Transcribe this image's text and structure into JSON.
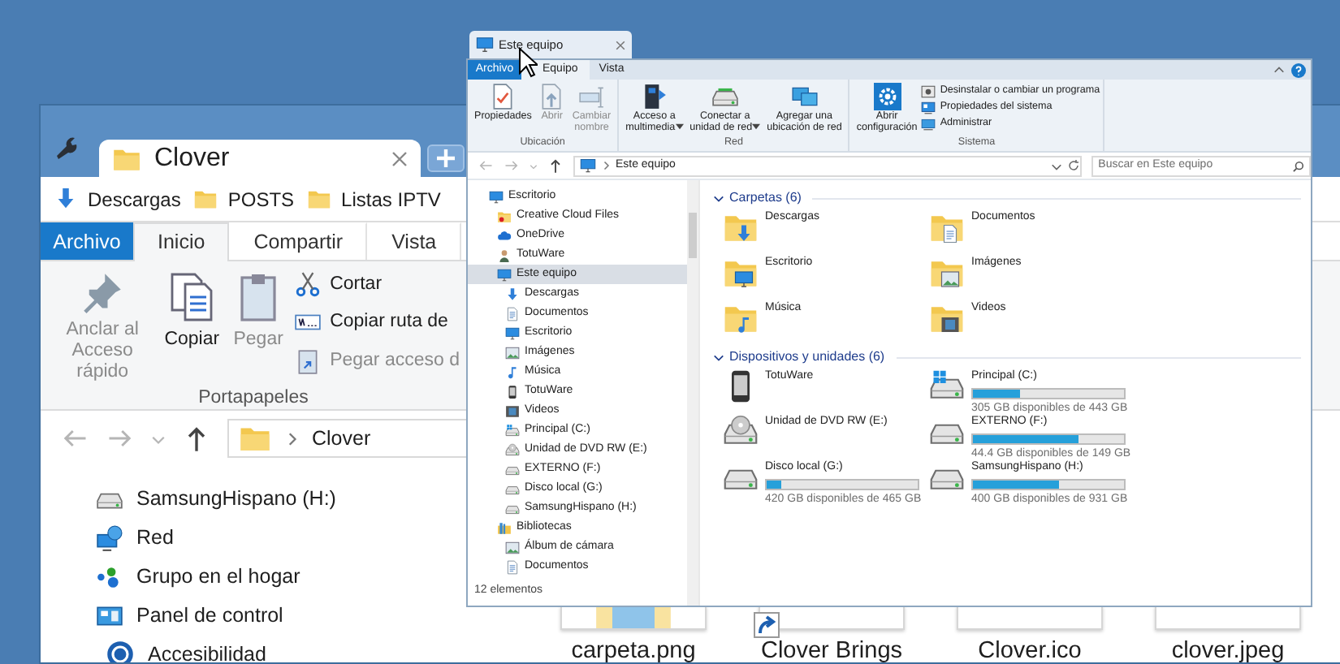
{
  "clover_window": {
    "tab": {
      "title": "Clover"
    },
    "bookmarks": [
      {
        "label": "Descargas",
        "kind": "download"
      },
      {
        "label": "POSTS",
        "kind": "folder"
      },
      {
        "label": "Listas IPTV",
        "kind": "folder"
      }
    ],
    "ribbon_tabs": [
      {
        "label": "Archivo",
        "kind": "file",
        "selected": false
      },
      {
        "label": "Inicio",
        "kind": "tab",
        "selected": true
      },
      {
        "label": "Compartir",
        "kind": "tab",
        "selected": false
      },
      {
        "label": "Vista",
        "kind": "tab",
        "selected": false
      }
    ],
    "clipboard_group": {
      "label": "Portapapeles",
      "large_buttons": [
        {
          "label": "Anclar al\nAcceso rápido",
          "kind": "pin",
          "disabled": true
        },
        {
          "label": "Copiar",
          "kind": "copy",
          "disabled": false
        },
        {
          "label": "Pegar",
          "kind": "paste",
          "disabled": true
        }
      ],
      "small_buttons": [
        {
          "label": "Cortar",
          "kind": "cut",
          "disabled": false
        },
        {
          "label": "Copiar ruta de",
          "kind": "path",
          "disabled": false
        },
        {
          "label": "Pegar acceso d",
          "kind": "shortcut",
          "disabled": true
        }
      ]
    },
    "address": {
      "path": "Clover"
    },
    "navigation": [
      {
        "label": "SamsungHispano (H:)",
        "kind": "drive"
      },
      {
        "label": "Red",
        "kind": "network"
      },
      {
        "label": "Grupo en el hogar",
        "kind": "homegroup"
      },
      {
        "label": "Panel de control",
        "kind": "control-panel",
        "children": [
          {
            "label": "Accesibilidad",
            "kind": "accessibility"
          }
        ]
      }
    ],
    "files": [
      {
        "name": "carpeta.png",
        "kind": "folder-image"
      },
      {
        "name": "Clover Brings",
        "kind": "shortcut"
      },
      {
        "name": "Clover.ico",
        "kind": "plain"
      },
      {
        "name": "clover.jpeg",
        "kind": "plain"
      }
    ]
  },
  "explorer_window": {
    "tab": {
      "title": "Este equipo"
    },
    "ribbon_tabs": [
      {
        "label": "Archivo",
        "kind": "file",
        "selected": false
      },
      {
        "label": "Equipo",
        "kind": "tab",
        "selected": true
      },
      {
        "label": "Vista",
        "kind": "tab",
        "selected": false
      }
    ],
    "groups": [
      {
        "label": "Ubicación",
        "buttons": [
          {
            "label": "Propiedades",
            "kind": "properties",
            "disabled": false,
            "menu": false
          },
          {
            "label": "Abrir",
            "kind": "open",
            "disabled": true,
            "menu": false
          },
          {
            "label": "Cambiar\nnombre",
            "kind": "rename",
            "disabled": true,
            "menu": false
          }
        ]
      },
      {
        "label": "Red",
        "buttons": [
          {
            "label": "Acceso a\nmultimedia",
            "kind": "media",
            "disabled": false,
            "menu": true
          },
          {
            "label": "Conectar a\nunidad de red",
            "kind": "map-drive",
            "disabled": false,
            "menu": true
          },
          {
            "label": "Agregar una\nubicación de red",
            "kind": "add-network",
            "disabled": false,
            "menu": false
          }
        ]
      },
      {
        "label": "Sistema",
        "buttons": [
          {
            "label": "Abrir\nconfiguración",
            "kind": "settings",
            "disabled": false,
            "menu": false
          }
        ],
        "small_buttons": [
          {
            "label": "Desinstalar o cambiar un programa",
            "kind": "uninstall"
          },
          {
            "label": "Propiedades del sistema",
            "kind": "system"
          },
          {
            "label": "Administrar",
            "kind": "manage"
          }
        ]
      }
    ],
    "address": {
      "path": "Este equipo"
    },
    "search": {
      "placeholder": "Buscar en Este equipo"
    },
    "tree": [
      {
        "label": "Escritorio",
        "kind": "desktop",
        "selected": false,
        "children": [
          {
            "label": "Creative Cloud Files",
            "kind": "cc-folder",
            "selected": false
          },
          {
            "label": "OneDrive",
            "kind": "cloud",
            "selected": false
          },
          {
            "label": "TotuWare",
            "kind": "person",
            "selected": false
          },
          {
            "label": "Este equipo",
            "kind": "desktop",
            "selected": true,
            "children": [
              {
                "label": "Descargas",
                "kind": "download",
                "selected": false
              },
              {
                "label": "Documentos",
                "kind": "document",
                "selected": false
              },
              {
                "label": "Escritorio",
                "kind": "desktop",
                "selected": false
              },
              {
                "label": "Imágenes",
                "kind": "image",
                "selected": false
              },
              {
                "label": "Música",
                "kind": "music",
                "selected": false
              },
              {
                "label": "TotuWare",
                "kind": "phone",
                "selected": false
              },
              {
                "label": "Videos",
                "kind": "video",
                "selected": false
              },
              {
                "label": "Principal (C:)",
                "kind": "windows-drive",
                "selected": false
              },
              {
                "label": "Unidad de DVD RW (E:)",
                "kind": "dvd",
                "selected": false
              },
              {
                "label": "EXTERNO (F:)",
                "kind": "drive",
                "selected": false
              },
              {
                "label": "Disco local (G:)",
                "kind": "drive",
                "selected": false
              },
              {
                "label": "SamsungHispano (H:)",
                "kind": "drive",
                "selected": false
              }
            ]
          },
          {
            "label": "Bibliotecas",
            "kind": "library",
            "selected": false,
            "children": [
              {
                "label": "Álbum de cámara",
                "kind": "image",
                "selected": false
              },
              {
                "label": "Documentos",
                "kind": "document",
                "selected": false
              }
            ]
          }
        ]
      }
    ],
    "status": "12 elementos",
    "sections": [
      {
        "title": "Carpetas (6)",
        "expanded": true,
        "items": [
          {
            "name": "Descargas",
            "kind": "download"
          },
          {
            "name": "Documentos",
            "kind": "document"
          },
          {
            "name": "Escritorio",
            "kind": "desktop"
          },
          {
            "name": "Imágenes",
            "kind": "image"
          },
          {
            "name": "Música",
            "kind": "music"
          },
          {
            "name": "Videos",
            "kind": "video"
          }
        ]
      },
      {
        "title": "Dispositivos y unidades (6)",
        "expanded": true,
        "items": [
          {
            "name": "TotuWare",
            "kind": "phone"
          },
          {
            "name": "Principal (C:)",
            "kind": "windows-drive",
            "level": 0.31,
            "reading": "305 GB disponibles de 443 GB"
          },
          {
            "name": "Unidad de DVD RW (E:)",
            "kind": "dvd"
          },
          {
            "name": "EXTERNO (F:)",
            "kind": "drive",
            "level": 0.7,
            "reading": "44.4 GB disponibles de 149 GB"
          },
          {
            "name": "Disco local (G:)",
            "kind": "drive",
            "level": 0.1,
            "reading": "420 GB disponibles de 465 GB"
          },
          {
            "name": "SamsungHispano (H:)",
            "kind": "drive",
            "level": 0.57,
            "reading": "400 GB disponibles de 931 GB"
          }
        ]
      }
    ]
  }
}
